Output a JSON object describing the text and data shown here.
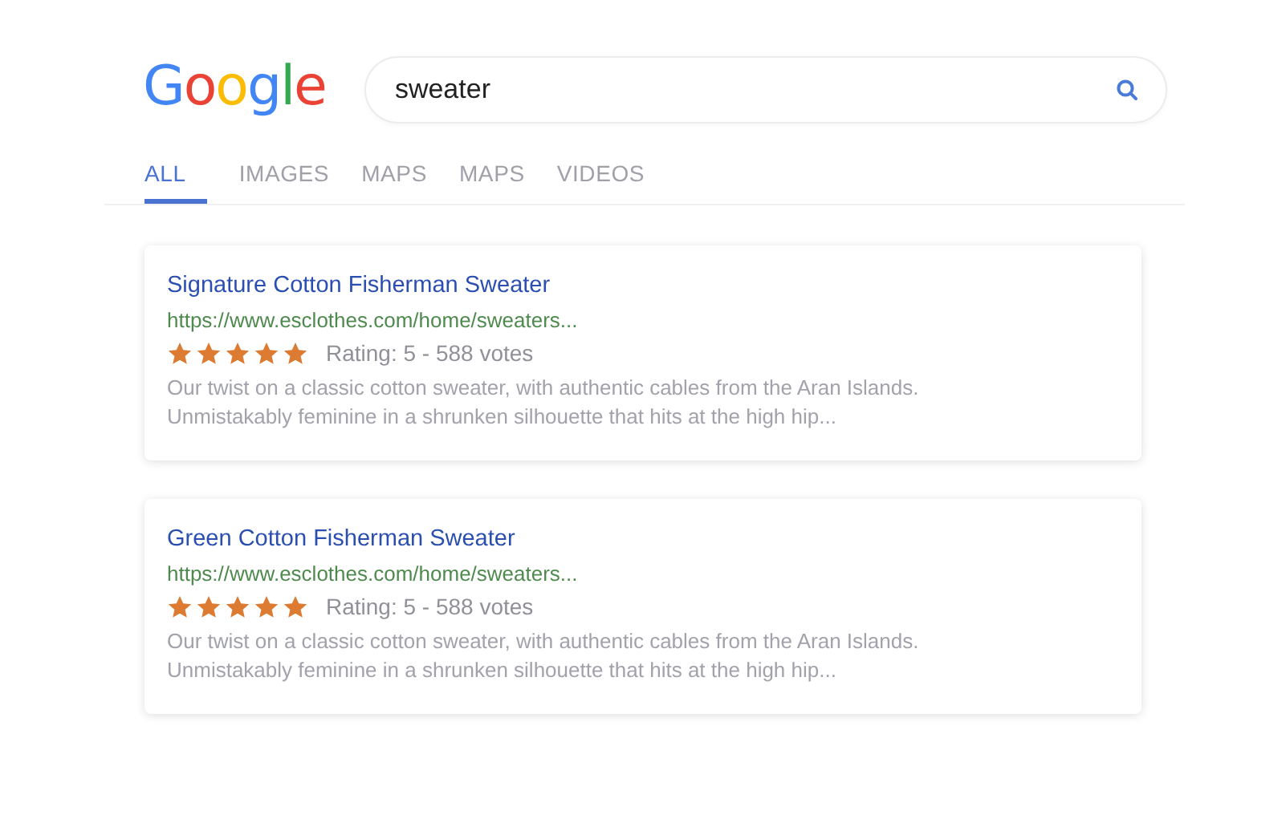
{
  "logo": "Google",
  "search": {
    "value": "sweater"
  },
  "tabs": [
    {
      "label": "ALL",
      "selected": true
    },
    {
      "label": "IMAGES",
      "selected": false
    },
    {
      "label": "MAPS",
      "selected": false
    },
    {
      "label": "MAPS",
      "selected": false
    },
    {
      "label": "VIDEOS",
      "selected": false
    }
  ],
  "results": [
    {
      "title": "Signature Cotton Fisherman Sweater",
      "url": "https://www.esclothes.com/home/sweaters...",
      "stars": 5,
      "rating": "Rating: 5 - 588 votes",
      "description": "Our twist on a classic cotton sweater, with authentic cables from the Aran Islands. Unmistakably feminine in a shrunken silhouette that hits at the high hip..."
    },
    {
      "title": "Green Cotton Fisherman Sweater",
      "url": "https://www.esclothes.com/home/sweaters...",
      "stars": 5,
      "rating": "Rating: 5 - 588 votes",
      "description": "Our twist on a classic cotton sweater, with authentic cables from the Aran Islands. Unmistakably feminine in a shrunken silhouette that hits at the high hip..."
    }
  ]
}
